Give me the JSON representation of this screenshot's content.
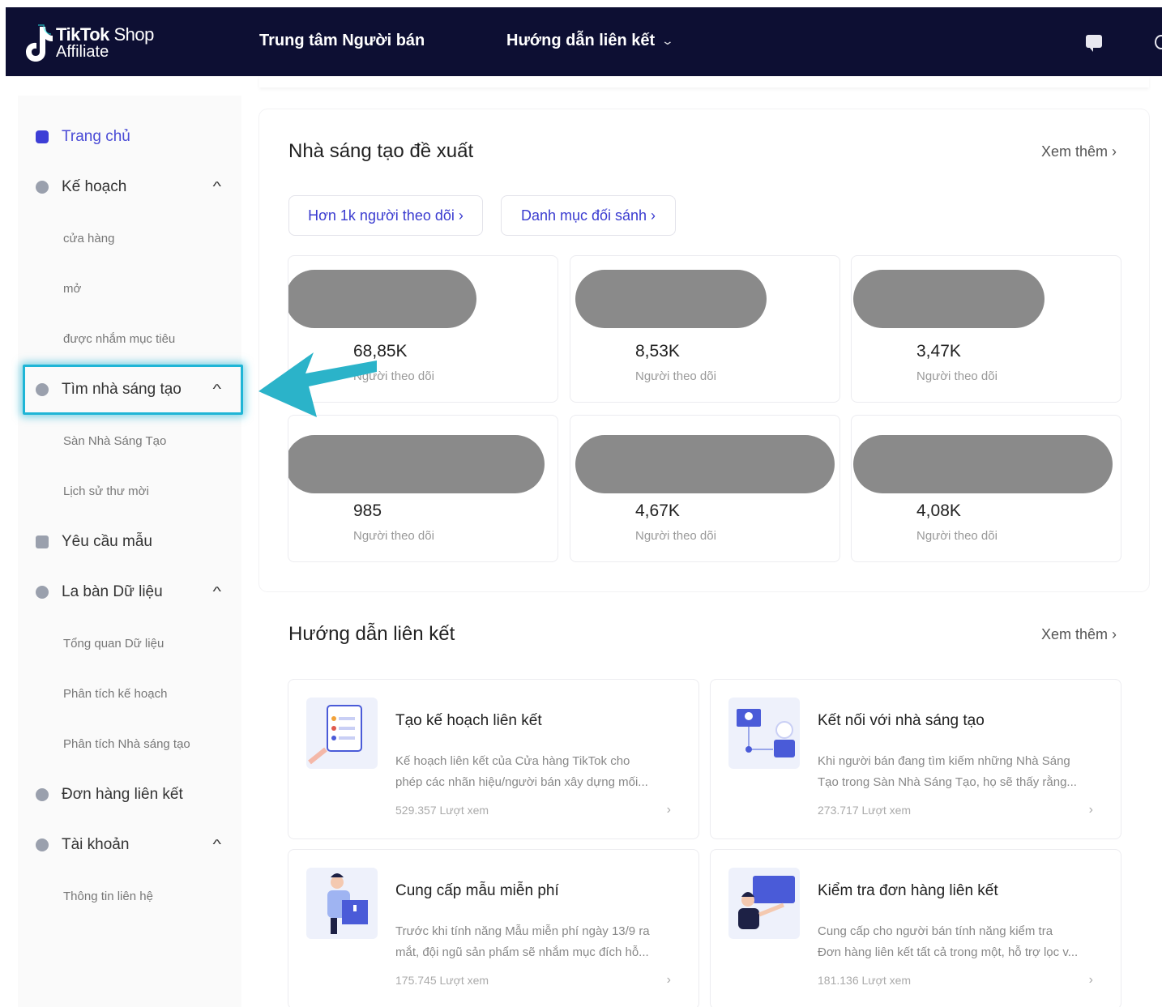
{
  "header": {
    "brand": "TikTok",
    "brand_shop": "Shop",
    "brand_sub": "Affiliate",
    "nav_seller_center": "Trung tâm Người bán",
    "nav_affiliate_guide": "Hướng dẫn liên kết",
    "icons": [
      "chat-icon",
      "globe-icon"
    ]
  },
  "sidebar": {
    "home": "Trang chủ",
    "plan": "Kế hoạch",
    "plan_sub": [
      "cửa hàng",
      "mở",
      "được nhắm mục tiêu"
    ],
    "find_creators": "Tìm nhà sáng tạo",
    "find_creators_sub": [
      "Sàn Nhà Sáng Tạo",
      "Lịch sử thư mời"
    ],
    "sample_requests": "Yêu cầu mẫu",
    "data_compass": "La bàn Dữ liệu",
    "data_compass_sub": [
      "Tổng quan Dữ liệu",
      "Phân tích kế hoạch",
      "Phân tích Nhà sáng tạo"
    ],
    "affiliate_orders": "Đơn hàng liên kết",
    "account": "Tài khoản",
    "account_sub": [
      "Thông tin liên hệ"
    ],
    "active_color": "#1fb5d6"
  },
  "recommended": {
    "title": "Nhà sáng tạo đề xuất",
    "see_more": "Xem thêm",
    "filters": [
      "Hơn 1k người theo dõi",
      "Danh mục đối sánh"
    ],
    "follower_label": "Người theo dõi",
    "creators": [
      {
        "followers": "68,85K"
      },
      {
        "followers": "8,53K"
      },
      {
        "followers": "3,47K"
      },
      {
        "followers": "985"
      },
      {
        "followers": "4,67K"
      },
      {
        "followers": "4,08K"
      }
    ]
  },
  "guides": {
    "title": "Hướng dẫn liên kết",
    "see_more": "Xem thêm",
    "items": [
      {
        "title": "Tạo kế hoạch liên kết",
        "desc1": "Kế hoạch liên kết của Cửa hàng TikTok cho",
        "desc2": "phép các nhãn hiệu/người bán xây dựng mối...",
        "views": "529.357 Lượt xem"
      },
      {
        "title": "Kết nối với nhà sáng tạo",
        "desc1": "Khi người bán đang tìm kiếm những Nhà Sáng",
        "desc2": "Tạo trong Sàn Nhà Sáng Tạo, họ sẽ thấy rằng...",
        "views": "273.717 Lượt xem"
      },
      {
        "title": "Cung cấp mẫu miễn phí",
        "desc1": "Trước khi tính năng Mẫu miễn phí ngày 13/9 ra",
        "desc2": "mắt, đội ngũ sản phẩm sẽ nhắm mục đích hỗ...",
        "views": "175.745 Lượt xem"
      },
      {
        "title": "Kiểm tra đơn hàng liên kết",
        "desc1": "Cung cấp cho người bán tính năng kiểm tra",
        "desc2": "Đơn hàng liên kết tất cả trong một, hỗ trợ lọc v...",
        "views": "181.136 Lượt xem"
      }
    ]
  },
  "colors": {
    "header_bg": "#0d0f33",
    "accent": "#3a3bd0",
    "annotation_arrow": "#2bb3c9"
  }
}
